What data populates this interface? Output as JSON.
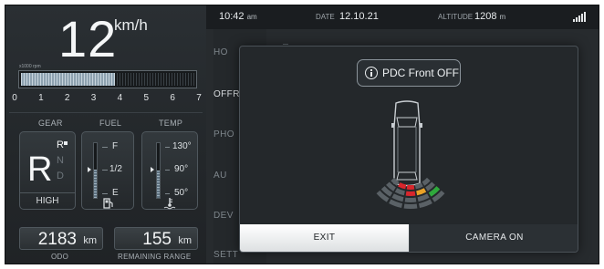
{
  "speed": {
    "value": "12",
    "unit": "km/h"
  },
  "rpm": {
    "caption": "x1000 rpm",
    "fill_fraction": 0.54,
    "ticks": [
      "0",
      "1",
      "2",
      "3",
      "4",
      "5",
      "6",
      "7"
    ]
  },
  "gear": {
    "label": "GEAR",
    "current": "R",
    "options": [
      "R",
      "N",
      "D"
    ],
    "mode": "HIGH"
  },
  "fuel": {
    "label": "FUEL",
    "scale": [
      "F",
      "1/2",
      "E"
    ],
    "level_fraction": 0.52,
    "icon": "fuel-pump-icon"
  },
  "temp": {
    "label": "TEMP",
    "scale": [
      "130°",
      "90°",
      "50°"
    ],
    "level_fraction": 0.5,
    "icon": "coolant-temperature-icon"
  },
  "odo": {
    "value": "2183",
    "unit": "km",
    "label": "ODO"
  },
  "range": {
    "value": "155",
    "unit": "km",
    "label": "REMAINING RANGE"
  },
  "topbar": {
    "time": "10:42",
    "time_suffix": "am",
    "date_label": "DATE",
    "date": "12.10.21",
    "altitude_label": "ALTITUDE",
    "altitude": "1208",
    "altitude_unit": "m",
    "signal_icon": "signal-strength-icon"
  },
  "menu": {
    "items": [
      "HO",
      "OFFR",
      "PHO",
      "AU",
      "DEV",
      "SETT"
    ]
  },
  "dialog": {
    "message": "PDC Front OFF",
    "exit_label": "EXIT",
    "camera_label": "CAMERA ON",
    "sensor_colors": {
      "red": "#d8262c",
      "orange": "#e9a126",
      "green": "#2fa83c",
      "idle": "#5a6166"
    }
  }
}
